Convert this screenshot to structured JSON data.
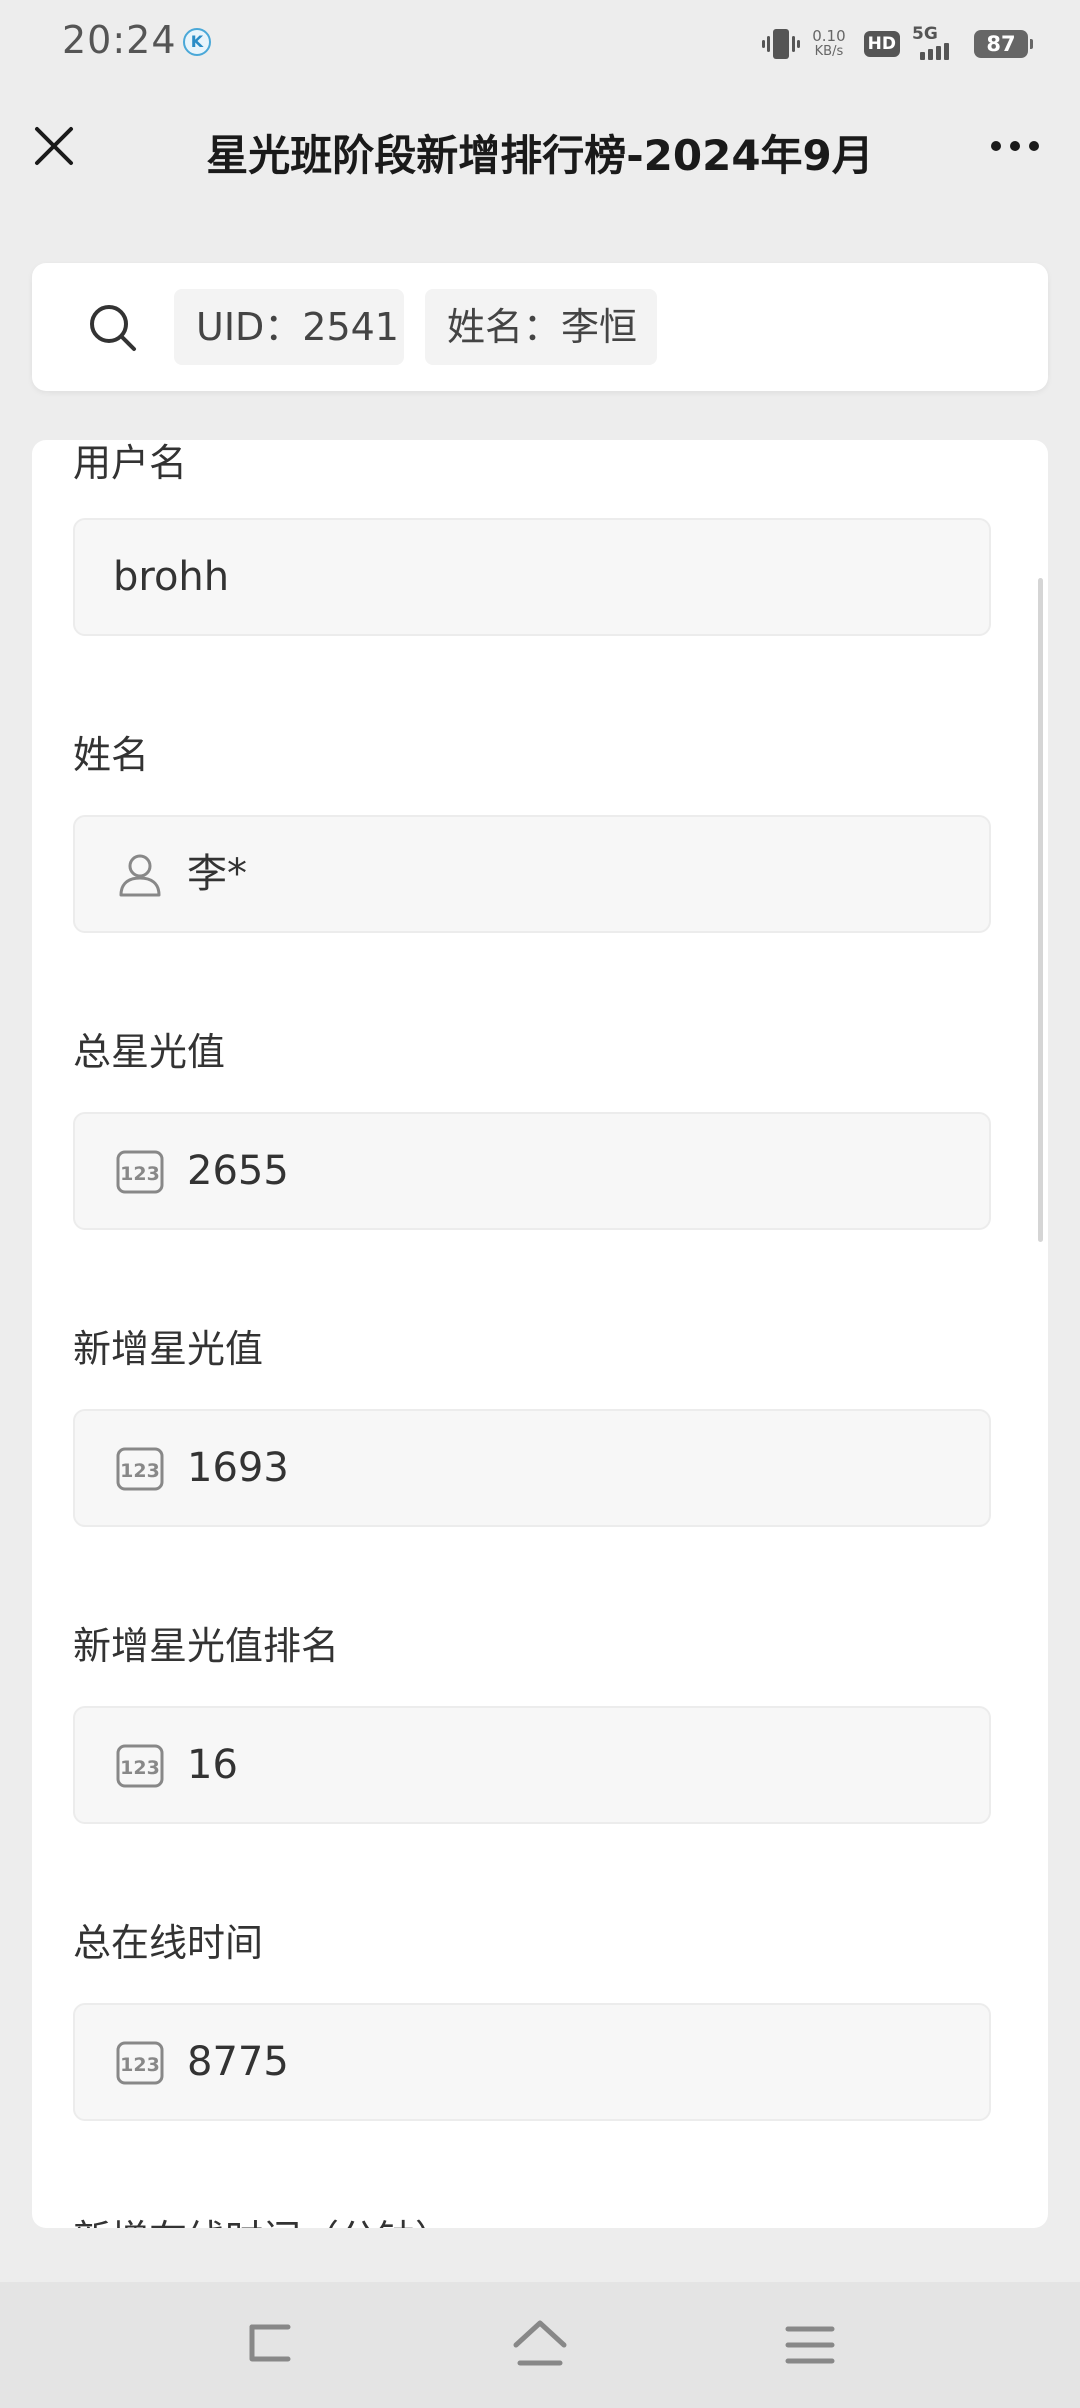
{
  "status_bar": {
    "time": "20:24",
    "app_icon_letter": "K",
    "net_speed_value": "0.10",
    "net_speed_unit": "KB/s",
    "hd_label": "HD",
    "network_gen": "5G",
    "battery_level": "87",
    "icons": [
      "vibrate-icon",
      "hd-icon",
      "signal-icon",
      "battery-icon"
    ]
  },
  "header": {
    "title": "星光班阶段新增排行榜-2024年9月",
    "close_icon": "close-icon",
    "more_icon": "more-icon"
  },
  "search": {
    "icon": "search-icon",
    "filters": [
      {
        "label": "UID：2541"
      },
      {
        "label": "姓名：李恒"
      }
    ]
  },
  "form": {
    "fields": [
      {
        "label": "用户名",
        "value": "brohh",
        "icon": ""
      },
      {
        "label": "姓名",
        "value": "李*",
        "icon": "person-icon"
      },
      {
        "label": "总星光值",
        "value": "2655",
        "icon": "number-icon"
      },
      {
        "label": "新增星光值",
        "value": "1693",
        "icon": "number-icon"
      },
      {
        "label": "新增星光值排名",
        "value": "16",
        "icon": "number-icon"
      },
      {
        "label": "总在线时间",
        "value": "8775",
        "icon": "number-icon"
      },
      {
        "label": "新增在线时间（分钟）",
        "value": "",
        "icon": ""
      }
    ]
  },
  "nav_bar": {
    "icons": [
      "back-icon",
      "home-icon",
      "menu-icon"
    ]
  }
}
